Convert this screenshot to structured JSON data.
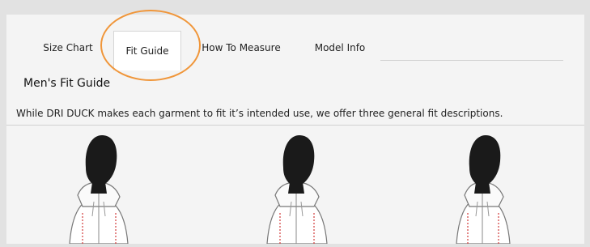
{
  "tabs": {
    "size_chart": "Size Chart",
    "fit_guide": "Fit Guide",
    "how_to_measure": "How To Measure",
    "model_info": "Model Info"
  },
  "heading": "Men's Fit Guide",
  "description": "While DRI DUCK makes each garment to fit it’s intended use, we offer three general fit descriptions.",
  "colors": {
    "highlight": "#f0963a",
    "silhouette": "#1a1a1a",
    "stitch": "#d23a3a"
  },
  "figures": [
    {
      "icon": "hooded-jacket-figure-icon"
    },
    {
      "icon": "hooded-jacket-figure-icon"
    },
    {
      "icon": "hooded-jacket-figure-icon"
    }
  ]
}
